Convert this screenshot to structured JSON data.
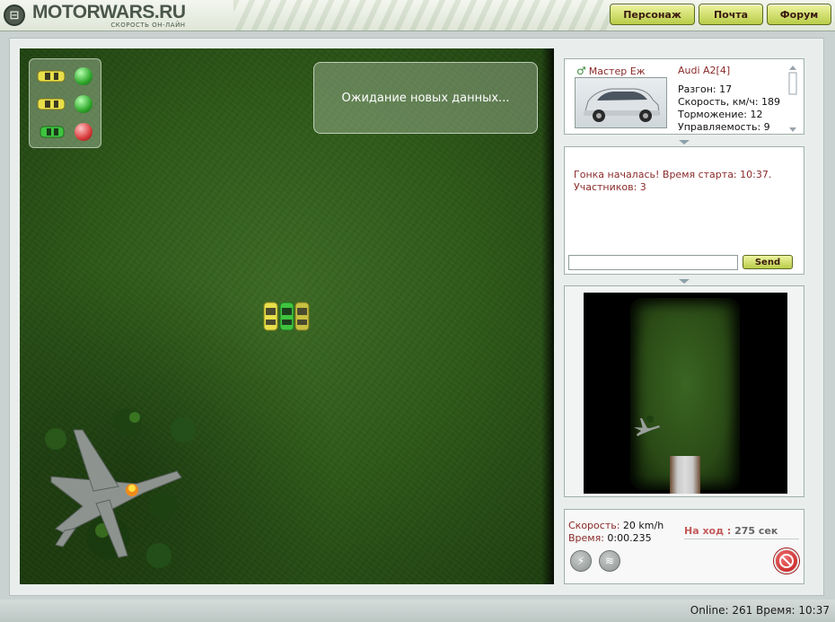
{
  "header": {
    "logo_icon": "⊟",
    "logo_title": "MOTORWARS.RU",
    "logo_subtitle": "СКОРОСТЬ ОН-ЛАЙН",
    "nav": [
      {
        "label": "Персонаж"
      },
      {
        "label": "Почта"
      },
      {
        "label": "Форум"
      }
    ]
  },
  "game": {
    "status_message": "Ожидание новых данных...",
    "players_status": [
      {
        "car_color": "#e8e04a",
        "light": "green"
      },
      {
        "car_color": "#e8e04a",
        "light": "green"
      },
      {
        "car_color": "#3fc43f",
        "light": "red"
      }
    ]
  },
  "car_info": {
    "driver": "Мастер Еж",
    "driver_icon": "male-icon",
    "car": "Audi A2[4]",
    "stats": [
      "Разгон: 17",
      "Скорость, км/ч: 189",
      "Торможение: 12",
      "Управляемость: 9"
    ]
  },
  "chat": {
    "messages": [
      "Гонка началась! Время старта: 10:37.",
      "Участников: 3"
    ],
    "input_value": "",
    "send_label": "Send"
  },
  "speed": {
    "speed_label": "Скорость:",
    "speed_value": "20 km/h",
    "time_label": "Время:",
    "time_value": "0:00.235",
    "turn_label": "На ход :",
    "turn_value": "275 сек"
  },
  "footer": {
    "status": "Online: 261  Время: 10:37"
  },
  "colors": {
    "accent": "#b8cc48",
    "label_red": "#8b2a2a",
    "grass": "#2f5a1a"
  }
}
